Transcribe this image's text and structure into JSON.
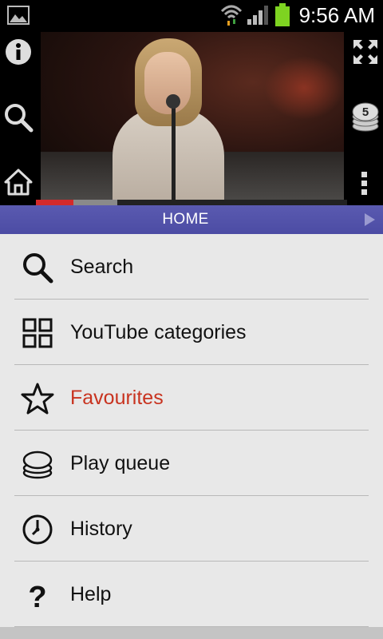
{
  "status_bar": {
    "time": "9:56 AM",
    "icons": [
      "picture-icon",
      "wifi-icon",
      "signal-icon",
      "battery-icon"
    ],
    "battery_color": "#7ed321"
  },
  "player": {
    "left_controls": [
      "info-icon",
      "search-icon",
      "home-icon"
    ],
    "right_controls": [
      "fullscreen-icon",
      "queue-icon",
      "more-icon"
    ],
    "queue_count": "5",
    "progress": {
      "played_fraction": 0.12,
      "buffered_fraction": 0.26
    },
    "progress_color": "#d42a2a"
  },
  "header": {
    "title": "HOME",
    "color": "#5252aa"
  },
  "menu": {
    "items": [
      {
        "label": "Search",
        "icon": "search-icon",
        "color": "#111111"
      },
      {
        "label": "YouTube categories",
        "icon": "grid-icon",
        "color": "#111111"
      },
      {
        "label": "Favourites",
        "icon": "star-icon",
        "color": "#c8331f"
      },
      {
        "label": "Play queue",
        "icon": "stack-icon",
        "color": "#111111"
      },
      {
        "label": "History",
        "icon": "clock-icon",
        "color": "#111111"
      },
      {
        "label": "Help",
        "icon": "question-icon",
        "color": "#111111"
      }
    ]
  }
}
